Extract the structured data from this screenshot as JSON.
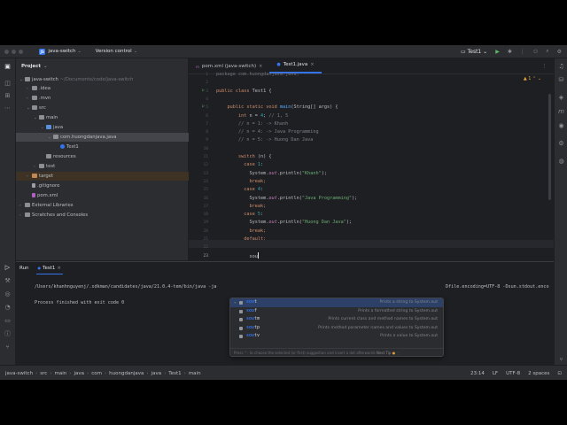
{
  "titlebar": {
    "project_badge": "JS",
    "project_name": "java-switch",
    "vcs_label": "Version control",
    "run_config": "Test1"
  },
  "project_panel": {
    "title": "Project",
    "root_name": "java-switch",
    "root_path": "~/Documents/code/java-switch",
    "nodes": [
      ".idea",
      ".mvn",
      "src",
      "main",
      "java",
      "com.huongdanjava.java",
      "Test1",
      "resources",
      "test",
      "target",
      ".gitignore",
      "pom.xml",
      "External Libraries",
      "Scratches and Consoles"
    ]
  },
  "editor": {
    "tabs": [
      {
        "label": "pom.xml (java-switch)"
      },
      {
        "label": "Test1.java"
      }
    ],
    "warnings": "1",
    "line_numbers": [
      "1",
      "2",
      "3",
      "4",
      "5",
      "6",
      "7",
      "8",
      "9",
      "10",
      "11",
      "12",
      "13",
      "14",
      "15",
      "16",
      "17",
      "18",
      "19",
      "20",
      "21",
      "22",
      "23"
    ],
    "code": {
      "l1": "package com.huongdanjava.java;",
      "l3": "public class Test1 {",
      "l5": "    public static void main(String[] args) {",
      "l6_kw": "int",
      "l6_a": " n = ",
      "l6_num": "4",
      "l6_b": "; ",
      "l6_cm": "// 1, 5",
      "l7": "// n = 1: -> Khanh",
      "l8": "// n = 4: -> Java Programming",
      "l9": "// n = 5: -> Huong Dan Java",
      "l11_kw": "switch",
      "l11_rest": " (n) {",
      "case_kw": "case",
      "case1_num": "1",
      "case2_num": "4",
      "case3_num": "5",
      "colon": ":",
      "sys": "System.",
      "out": "out",
      "println": ".println(",
      "str1": "\"Khanh\"",
      "str2": "\"Java Programming\"",
      "str3": "\"Huong Dan Java\"",
      "close": ");",
      "break": "break;",
      "default": "default:",
      "typed": "sou"
    }
  },
  "autocomplete": {
    "items": [
      {
        "name": "sout",
        "desc": "Prints a string to System.out"
      },
      {
        "name": "souf",
        "desc": "Prints a formatted string to System.out"
      },
      {
        "name": "soutm",
        "desc": "Prints current class and method names to System.out"
      },
      {
        "name": "soutp",
        "desc": "Prints method parameter names and values to System.out"
      },
      {
        "name": "soutv",
        "desc": "Prints a value to System.out"
      }
    ],
    "footer": "Press ^. to choose the selected (or first) suggestion and insert a dot afterwards",
    "tip": "Next Tip"
  },
  "run_panel": {
    "title": "Run",
    "tab": "Test1",
    "command": "/Users/khanhnguyenj/.sdkman/candidates/java/21.0.4-tem/bin/java -ja",
    "command_tail": "Dfile.encoding=UTF-8 -Dsun.stdout.enco",
    "exit": "Process finished with exit code 0"
  },
  "statusbar": {
    "crumbs": [
      "java-switch",
      "src",
      "main",
      "java",
      "com",
      "huongdanjava",
      "java",
      "Test1",
      "main"
    ],
    "position": "23:14",
    "line_sep": "LF",
    "encoding": "UTF-8",
    "indent": "2 spaces"
  }
}
